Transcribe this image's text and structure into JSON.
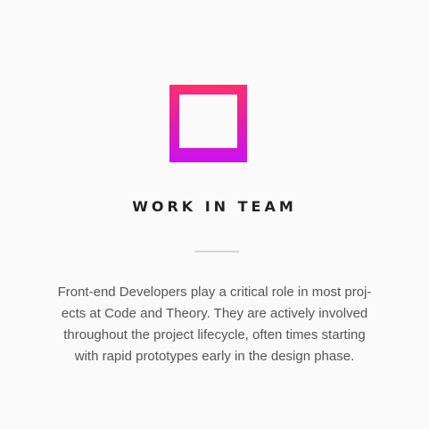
{
  "feature": {
    "icon": "gradient-square-outline-icon",
    "gradient_colors": [
      "#ff2e6e",
      "#cc11f4"
    ],
    "title": "WORK IN TEAM",
    "description_lines": [
      "Front-end Developers play a critical role in most proj-",
      "ects at Code and Theory. They are actively involved",
      "throughout the project lifecycle, often times starting",
      "with rapid prototypes early in the design phase."
    ]
  }
}
